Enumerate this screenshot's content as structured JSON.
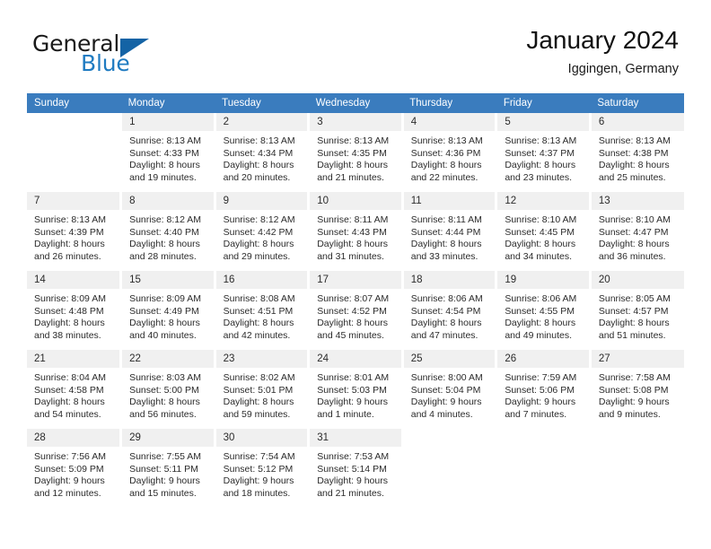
{
  "brand": {
    "name_part1": "General",
    "name_part2": "Blue",
    "triangle_color": "#1463a5",
    "blue_color": "#1f7bc1"
  },
  "header": {
    "title": "January 2024",
    "subtitle": "Iggingen, Germany"
  },
  "theme": {
    "header_row_bg": "#3a7cbe",
    "day_number_bg": "#f0f0f0",
    "text_color": "#2b2b2b"
  },
  "weekday_headers": [
    "Sunday",
    "Monday",
    "Tuesday",
    "Wednesday",
    "Thursday",
    "Friday",
    "Saturday"
  ],
  "weeks": [
    [
      {
        "day": "",
        "blank": true,
        "lines": []
      },
      {
        "day": "1",
        "blank": false,
        "lines": [
          "Sunrise: 8:13 AM",
          "Sunset: 4:33 PM",
          "Daylight: 8 hours",
          "and 19 minutes."
        ]
      },
      {
        "day": "2",
        "blank": false,
        "lines": [
          "Sunrise: 8:13 AM",
          "Sunset: 4:34 PM",
          "Daylight: 8 hours",
          "and 20 minutes."
        ]
      },
      {
        "day": "3",
        "blank": false,
        "lines": [
          "Sunrise: 8:13 AM",
          "Sunset: 4:35 PM",
          "Daylight: 8 hours",
          "and 21 minutes."
        ]
      },
      {
        "day": "4",
        "blank": false,
        "lines": [
          "Sunrise: 8:13 AM",
          "Sunset: 4:36 PM",
          "Daylight: 8 hours",
          "and 22 minutes."
        ]
      },
      {
        "day": "5",
        "blank": false,
        "lines": [
          "Sunrise: 8:13 AM",
          "Sunset: 4:37 PM",
          "Daylight: 8 hours",
          "and 23 minutes."
        ]
      },
      {
        "day": "6",
        "blank": false,
        "lines": [
          "Sunrise: 8:13 AM",
          "Sunset: 4:38 PM",
          "Daylight: 8 hours",
          "and 25 minutes."
        ]
      }
    ],
    [
      {
        "day": "7",
        "blank": false,
        "lines": [
          "Sunrise: 8:13 AM",
          "Sunset: 4:39 PM",
          "Daylight: 8 hours",
          "and 26 minutes."
        ]
      },
      {
        "day": "8",
        "blank": false,
        "lines": [
          "Sunrise: 8:12 AM",
          "Sunset: 4:40 PM",
          "Daylight: 8 hours",
          "and 28 minutes."
        ]
      },
      {
        "day": "9",
        "blank": false,
        "lines": [
          "Sunrise: 8:12 AM",
          "Sunset: 4:42 PM",
          "Daylight: 8 hours",
          "and 29 minutes."
        ]
      },
      {
        "day": "10",
        "blank": false,
        "lines": [
          "Sunrise: 8:11 AM",
          "Sunset: 4:43 PM",
          "Daylight: 8 hours",
          "and 31 minutes."
        ]
      },
      {
        "day": "11",
        "blank": false,
        "lines": [
          "Sunrise: 8:11 AM",
          "Sunset: 4:44 PM",
          "Daylight: 8 hours",
          "and 33 minutes."
        ]
      },
      {
        "day": "12",
        "blank": false,
        "lines": [
          "Sunrise: 8:10 AM",
          "Sunset: 4:45 PM",
          "Daylight: 8 hours",
          "and 34 minutes."
        ]
      },
      {
        "day": "13",
        "blank": false,
        "lines": [
          "Sunrise: 8:10 AM",
          "Sunset: 4:47 PM",
          "Daylight: 8 hours",
          "and 36 minutes."
        ]
      }
    ],
    [
      {
        "day": "14",
        "blank": false,
        "lines": [
          "Sunrise: 8:09 AM",
          "Sunset: 4:48 PM",
          "Daylight: 8 hours",
          "and 38 minutes."
        ]
      },
      {
        "day": "15",
        "blank": false,
        "lines": [
          "Sunrise: 8:09 AM",
          "Sunset: 4:49 PM",
          "Daylight: 8 hours",
          "and 40 minutes."
        ]
      },
      {
        "day": "16",
        "blank": false,
        "lines": [
          "Sunrise: 8:08 AM",
          "Sunset: 4:51 PM",
          "Daylight: 8 hours",
          "and 42 minutes."
        ]
      },
      {
        "day": "17",
        "blank": false,
        "lines": [
          "Sunrise: 8:07 AM",
          "Sunset: 4:52 PM",
          "Daylight: 8 hours",
          "and 45 minutes."
        ]
      },
      {
        "day": "18",
        "blank": false,
        "lines": [
          "Sunrise: 8:06 AM",
          "Sunset: 4:54 PM",
          "Daylight: 8 hours",
          "and 47 minutes."
        ]
      },
      {
        "day": "19",
        "blank": false,
        "lines": [
          "Sunrise: 8:06 AM",
          "Sunset: 4:55 PM",
          "Daylight: 8 hours",
          "and 49 minutes."
        ]
      },
      {
        "day": "20",
        "blank": false,
        "lines": [
          "Sunrise: 8:05 AM",
          "Sunset: 4:57 PM",
          "Daylight: 8 hours",
          "and 51 minutes."
        ]
      }
    ],
    [
      {
        "day": "21",
        "blank": false,
        "lines": [
          "Sunrise: 8:04 AM",
          "Sunset: 4:58 PM",
          "Daylight: 8 hours",
          "and 54 minutes."
        ]
      },
      {
        "day": "22",
        "blank": false,
        "lines": [
          "Sunrise: 8:03 AM",
          "Sunset: 5:00 PM",
          "Daylight: 8 hours",
          "and 56 minutes."
        ]
      },
      {
        "day": "23",
        "blank": false,
        "lines": [
          "Sunrise: 8:02 AM",
          "Sunset: 5:01 PM",
          "Daylight: 8 hours",
          "and 59 minutes."
        ]
      },
      {
        "day": "24",
        "blank": false,
        "lines": [
          "Sunrise: 8:01 AM",
          "Sunset: 5:03 PM",
          "Daylight: 9 hours",
          "and 1 minute."
        ]
      },
      {
        "day": "25",
        "blank": false,
        "lines": [
          "Sunrise: 8:00 AM",
          "Sunset: 5:04 PM",
          "Daylight: 9 hours",
          "and 4 minutes."
        ]
      },
      {
        "day": "26",
        "blank": false,
        "lines": [
          "Sunrise: 7:59 AM",
          "Sunset: 5:06 PM",
          "Daylight: 9 hours",
          "and 7 minutes."
        ]
      },
      {
        "day": "27",
        "blank": false,
        "lines": [
          "Sunrise: 7:58 AM",
          "Sunset: 5:08 PM",
          "Daylight: 9 hours",
          "and 9 minutes."
        ]
      }
    ],
    [
      {
        "day": "28",
        "blank": false,
        "lines": [
          "Sunrise: 7:56 AM",
          "Sunset: 5:09 PM",
          "Daylight: 9 hours",
          "and 12 minutes."
        ]
      },
      {
        "day": "29",
        "blank": false,
        "lines": [
          "Sunrise: 7:55 AM",
          "Sunset: 5:11 PM",
          "Daylight: 9 hours",
          "and 15 minutes."
        ]
      },
      {
        "day": "30",
        "blank": false,
        "lines": [
          "Sunrise: 7:54 AM",
          "Sunset: 5:12 PM",
          "Daylight: 9 hours",
          "and 18 minutes."
        ]
      },
      {
        "day": "31",
        "blank": false,
        "lines": [
          "Sunrise: 7:53 AM",
          "Sunset: 5:14 PM",
          "Daylight: 9 hours",
          "and 21 minutes."
        ]
      },
      {
        "day": "",
        "blank": true,
        "lines": []
      },
      {
        "day": "",
        "blank": true,
        "lines": []
      },
      {
        "day": "",
        "blank": true,
        "lines": []
      }
    ]
  ]
}
